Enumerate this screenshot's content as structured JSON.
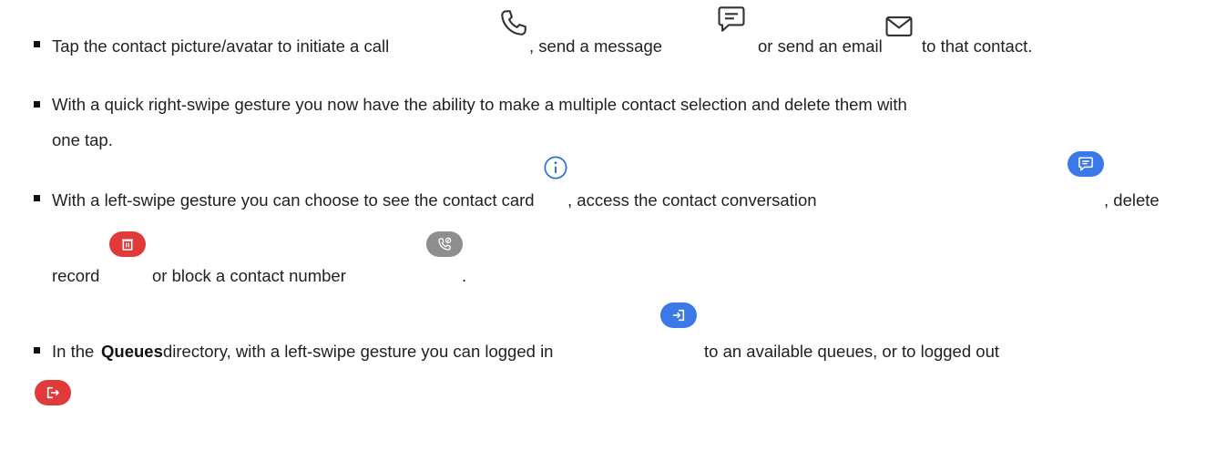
{
  "bullets": [
    {
      "t1": "Tap the contact picture/avatar to initiate a call",
      "t2": ", send a message",
      "t3": "or send an email",
      "t4": "to that contact."
    },
    {
      "line1": "With a quick right-swipe gesture you now have the ability to make a multiple contact selection and delete them with",
      "line2": "one tap."
    },
    {
      "t1": "With a left-swipe gesture you can choose to see the contact card",
      "t2": ", access the contact conversation",
      "t3": ", delete",
      "t4": "record",
      "t5": "or block a contact number",
      "t6": "."
    },
    {
      "t1": "In the",
      "bold": "Queues",
      "t2": "directory, with a left-swipe gesture you can logged in",
      "t3": "to an available queues, or to logged out"
    }
  ],
  "icons": [
    "phone-icon",
    "message-icon",
    "email-icon",
    "info-icon",
    "conversation-icon",
    "delete-icon",
    "block-icon",
    "login-icon",
    "logout-icon"
  ]
}
